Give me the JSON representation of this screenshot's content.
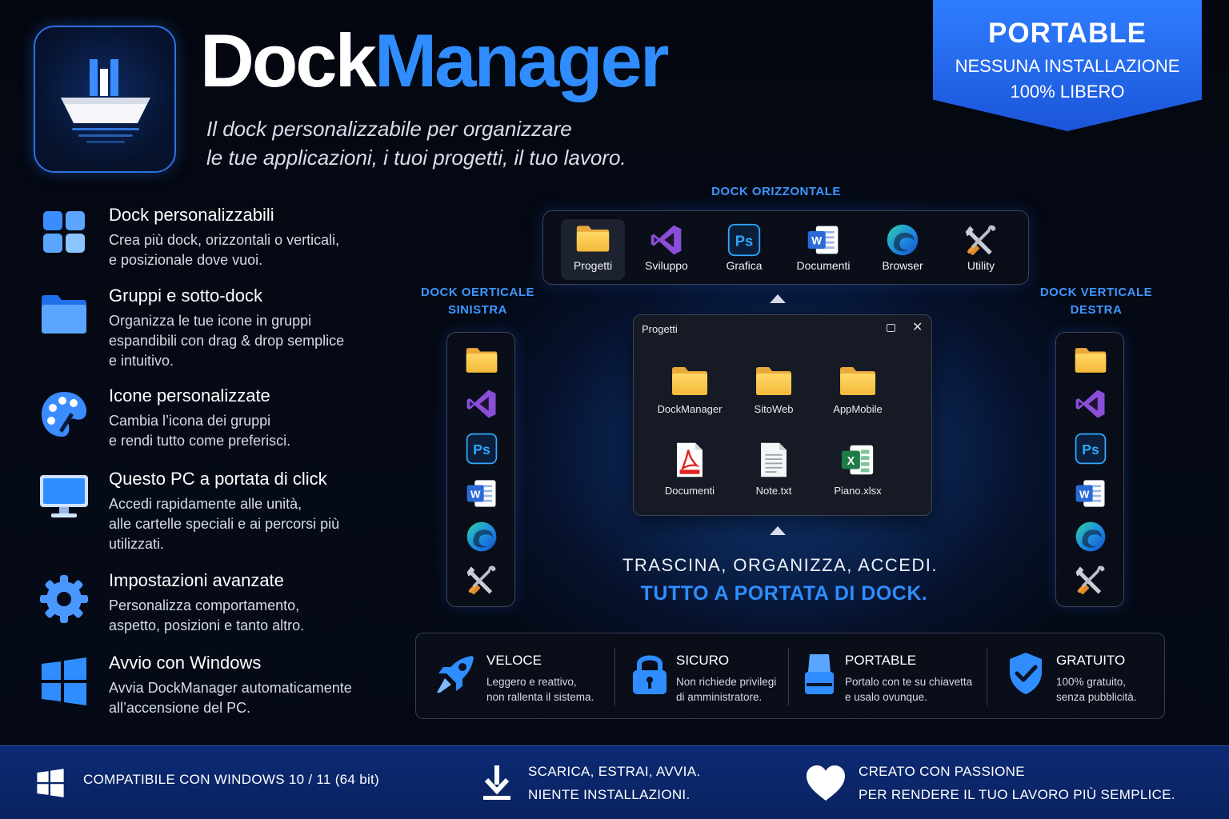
{
  "header": {
    "brand_part1": "Dock",
    "brand_part2": "Manager",
    "tagline_line1": "Il dock personalizzabile per organizzare",
    "tagline_line2": "le tue applicazioni, i tuoi progetti, il tuo lavoro."
  },
  "ribbon": {
    "title": "PORTABLE",
    "line1": "NESSUNA INSTALLAZIONE",
    "line2": "100% LIBERO"
  },
  "features": [
    {
      "title": "Dock personalizzabili",
      "line1": "Crea più dock, orizzontali o verticali,",
      "line2": "e posizionale dove vuoi.",
      "line3": ""
    },
    {
      "title": "Gruppi e sotto-dock",
      "line1": "Organizza le tue icone in gruppi",
      "line2": "espandibili con drag & drop semplice",
      "line3": "e intuitivo."
    },
    {
      "title": "Icone personalizzate",
      "line1": "Cambia l’icona dei gruppi",
      "line2": "e rendi tutto come preferisci.",
      "line3": ""
    },
    {
      "title": "Questo PC a portata di click",
      "line1": "Accedi rapidamente alle unità,",
      "line2": "alle cartelle speciali e ai percorsi più",
      "line3": "utilizzati."
    },
    {
      "title": "Impostazioni avanzate",
      "line1": "Personalizza comportamento,",
      "line2": "aspetto, posizioni e tanto altro.",
      "line3": ""
    },
    {
      "title": "Avvio con Windows",
      "line1": "Avvia DockManager automaticamente",
      "line2": "all’accensione del PC.",
      "line3": ""
    }
  ],
  "docks": {
    "horizontal_label": "DOCK ORIZZONTALE",
    "left_label_line1": "DOCK OERTICALE",
    "left_label_line2": "SINISTRA",
    "right_label_line1": "DOCK VERTICALE",
    "right_label_line2": "DESTRA",
    "horizontal_items": [
      "Progetti",
      "Sviluppo",
      "Grafica",
      "Documenti",
      "Browser",
      "Utility"
    ]
  },
  "window": {
    "title": "Progetti",
    "close_glyph": "✕",
    "files": [
      "DockManager",
      "SitoWeb",
      "AppMobile",
      "Documenti",
      "Note.txt",
      "Piano.xlsx"
    ]
  },
  "slogan": {
    "line1": "TRASCINA,  ORGANIZZA,  ACCEDI.",
    "line2": "TUTTO A PORTATA DI DOCK."
  },
  "benefits": [
    {
      "title": "VELOCE",
      "line1": "Leggero e reattivo,",
      "line2": "non rallenta il sistema."
    },
    {
      "title": "SICURO",
      "line1": "Non richiede privilegi",
      "line2": "di amministratore."
    },
    {
      "title": "PORTABLE",
      "line1": "Portalo con te su chiavetta",
      "line2": "e usalo ovunque."
    },
    {
      "title": "GRATUITO",
      "line1": "100% gratuito,",
      "line2": "senza pubblicità."
    }
  ],
  "footer": {
    "compat": "COMPATIBILE CON WINDOWS 10 / 11 (64 bit)",
    "download_line1": "SCARICA, ESTRAI, AVVIA.",
    "download_line2": "NIENTE INSTALLAZIONI.",
    "passion_line1": "CREATO CON PASSIONE",
    "passion_line2": "PER RENDERE IL TUO LAVORO PIÙ SEMPLICE."
  },
  "colors": {
    "accent": "#2f8dff",
    "ribbon": "#2f7dff",
    "footer": "#0c2a74",
    "folder": "#f7c948",
    "vs_purple": "#8a4fd8",
    "ps_blue": "#31a8ff",
    "word_blue": "#2b6ad6"
  }
}
